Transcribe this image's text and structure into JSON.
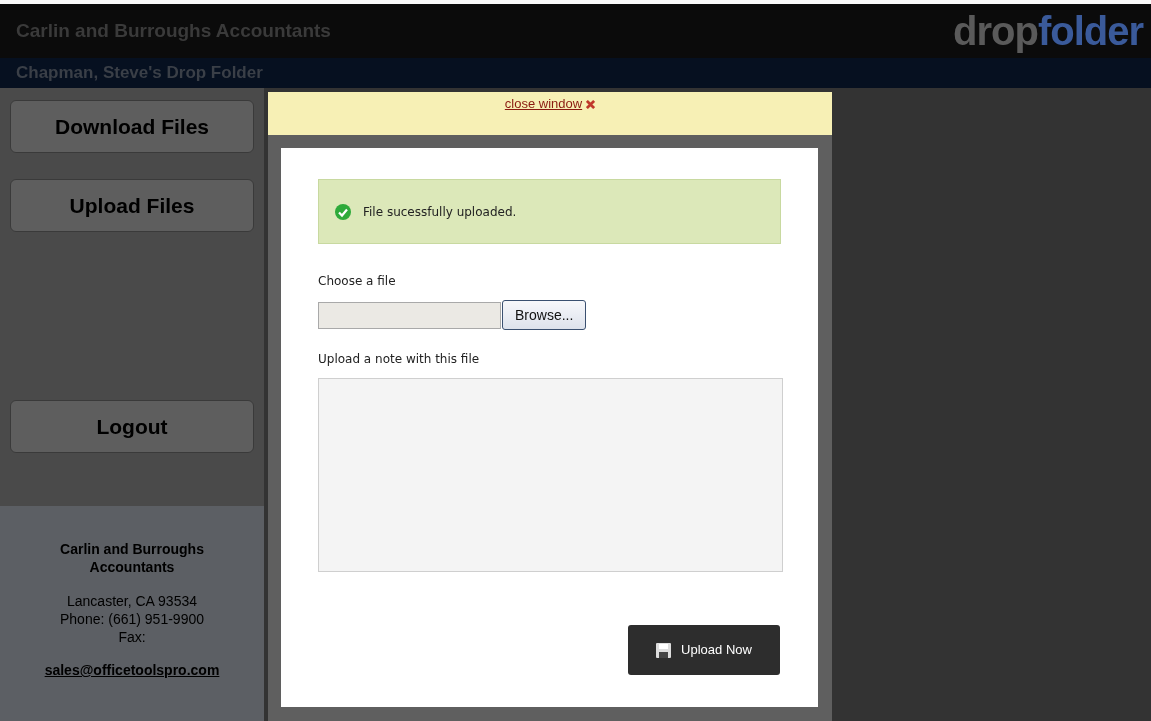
{
  "header": {
    "title": "Carlin and Burroughs Accountants",
    "logo": [
      "drop",
      "folder"
    ]
  },
  "subheader": {
    "title": "Chapman, Steve's Drop Folder"
  },
  "sidebar": {
    "buttons": [
      {
        "label": "Download Files"
      },
      {
        "label": "Upload Files"
      },
      {
        "label": "Logout"
      }
    ],
    "footer": {
      "company": [
        "Carlin and Burroughs",
        "Accountants"
      ],
      "address": [
        "Lancaster, CA 93534",
        "Phone: (661) 951-9900",
        "Fax:"
      ],
      "email": "sales@officetoolspro.com"
    }
  },
  "modal": {
    "close_link": "close window",
    "alert": "File sucessfully uploaded.",
    "file_label": "Choose a file",
    "browse_button": "Browse...",
    "note_label": "Upload a note with this file",
    "submit_button": "Upload Now"
  }
}
